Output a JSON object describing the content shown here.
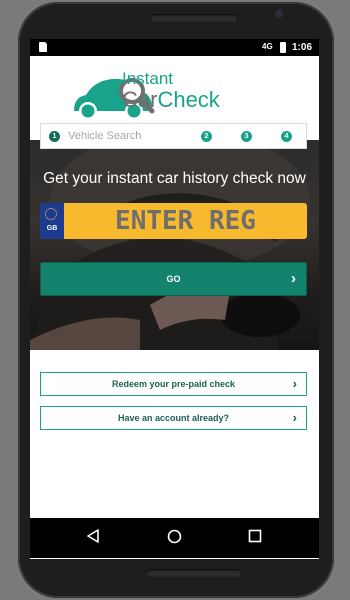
{
  "status_bar": {
    "time": "1:06",
    "signal": "4G"
  },
  "logo": {
    "line1": "Instant",
    "line2_a": "Car",
    "line2_b": "Check",
    "brand_color": "#1aa38b"
  },
  "steps": {
    "active": {
      "number": "1",
      "label": "Vehicle Search"
    },
    "others": [
      "2",
      "3",
      "4"
    ]
  },
  "hero": {
    "title": "Get your instant car history check now",
    "plate_country": "GB",
    "plate_placeholder": "ENTER REG",
    "go_label": "GO"
  },
  "actions": {
    "redeem_label": "Redeem your pre-paid check",
    "account_label": "Have an account already?"
  },
  "colors": {
    "primary": "#14836e",
    "plate_yellow": "#f7b92e",
    "eu_blue": "#1d3a8f"
  }
}
